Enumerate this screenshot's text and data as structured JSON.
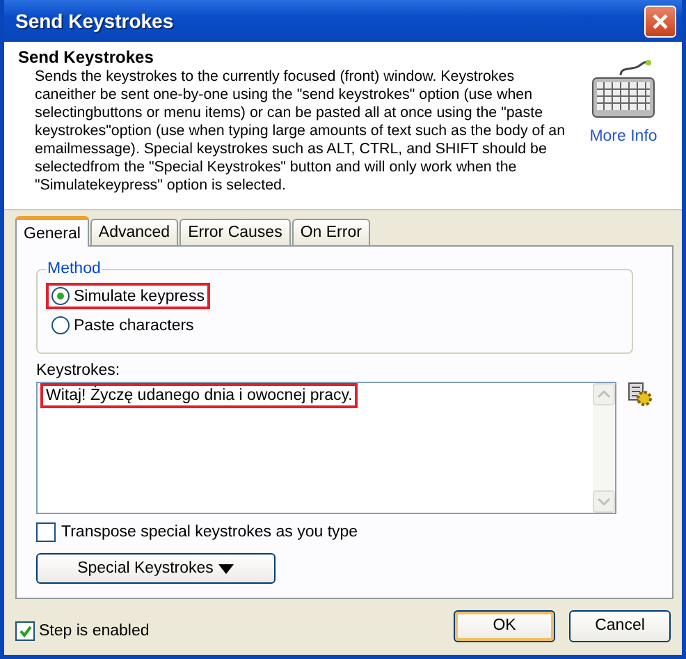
{
  "window": {
    "title": "Send Keystrokes"
  },
  "header": {
    "title": "Send Keystrokes",
    "description": "Sends the keystrokes to the currently focused (front) window.  Keystrokes caneither be sent one-by-one using the \"send keystrokes\" option (use when selectingbuttons or menu items) or can be pasted all at once using the \"paste keystrokes\"option (use when typing large amounts of text such as the body of an emailmessage).  Special keystrokes such as ALT, CTRL, and SHIFT should be selectedfrom the \"Special Keystrokes\" button and will only work when the \"Simulatekeypress\" option is selected.",
    "more_info": "More Info"
  },
  "tabs": [
    {
      "label": "General",
      "selected": true
    },
    {
      "label": "Advanced",
      "selected": false
    },
    {
      "label": "Error Causes",
      "selected": false
    },
    {
      "label": "On Error",
      "selected": false
    }
  ],
  "method": {
    "legend": "Method",
    "options": [
      {
        "label": "Simulate keypress",
        "selected": true,
        "highlighted": true
      },
      {
        "label": "Paste characters",
        "selected": false,
        "highlighted": false
      }
    ]
  },
  "keystrokes": {
    "label": "Keystrokes:",
    "value": "Witaj! Życzę udanego dnia i owocnej pracy.",
    "highlighted": true
  },
  "transpose": {
    "label": "Transpose special keystrokes as you type",
    "checked": false
  },
  "special_button": {
    "label": "Special Keystrokes"
  },
  "step_enabled": {
    "label": "Step is enabled",
    "checked": true
  },
  "buttons": [
    {
      "label": "OK",
      "default": true
    },
    {
      "label": "Cancel",
      "default": false
    }
  ]
}
